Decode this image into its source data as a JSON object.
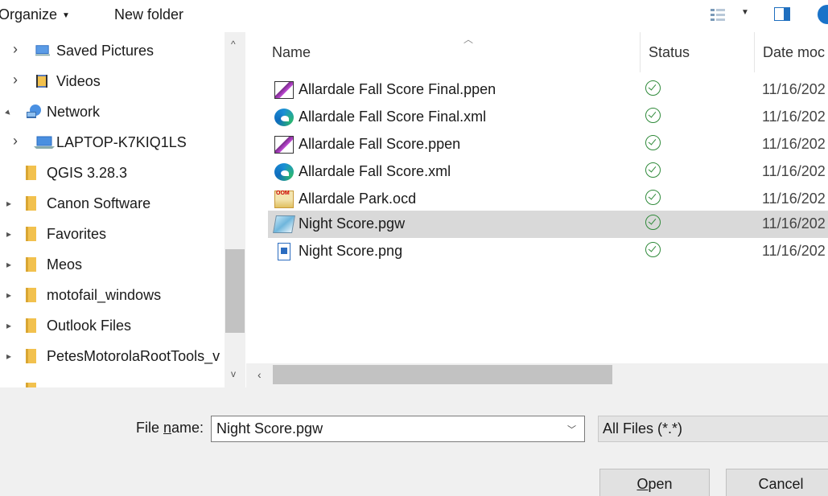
{
  "toolbar": {
    "organize_label": "Organize",
    "new_folder_label": "New folder"
  },
  "nav": {
    "items": [
      {
        "label": "Saved Pictures",
        "icon": "monitor-icon",
        "expander": "collapsed"
      },
      {
        "label": "Videos",
        "icon": "video-folder-icon",
        "expander": "collapsed"
      },
      {
        "label": "Network",
        "icon": "network-icon",
        "expander": "expanded"
      },
      {
        "label": "LAPTOP-K7KIQ1LS",
        "icon": "computer-icon",
        "expander": "collapsed"
      },
      {
        "label": "QGIS 3.28.3",
        "icon": "folder-icon",
        "expander": "none"
      },
      {
        "label": "Canon Software",
        "icon": "folder-icon",
        "expander": "collapsed"
      },
      {
        "label": "Favorites",
        "icon": "folder-icon",
        "expander": "collapsed"
      },
      {
        "label": "Meos",
        "icon": "folder-icon",
        "expander": "collapsed"
      },
      {
        "label": "motofail_windows",
        "icon": "folder-icon",
        "expander": "collapsed"
      },
      {
        "label": "Outlook Files",
        "icon": "folder-icon",
        "expander": "collapsed"
      },
      {
        "label": "PetesMotorolaRootTools_v",
        "icon": "folder-icon",
        "expander": "collapsed"
      }
    ]
  },
  "columns": {
    "name": "Name",
    "status": "Status",
    "date": "Date moc"
  },
  "files": [
    {
      "name": "Allardale Fall Score Final.ppen",
      "icon": "purplepen-icon",
      "status": "synced",
      "date": "11/16/202"
    },
    {
      "name": "Allardale Fall Score Final.xml",
      "icon": "edge-icon",
      "status": "synced",
      "date": "11/16/202"
    },
    {
      "name": "Allardale Fall Score.ppen",
      "icon": "purplepen-icon",
      "status": "synced",
      "date": "11/16/202"
    },
    {
      "name": "Allardale Fall Score.xml",
      "icon": "edge-icon",
      "status": "synced",
      "date": "11/16/202"
    },
    {
      "name": "Allardale Park.ocd",
      "icon": "ocad-icon",
      "status": "synced",
      "date": "11/16/202"
    },
    {
      "name": "Night Score.pgw",
      "icon": "pgw-file-icon",
      "status": "synced",
      "date": "11/16/202",
      "selected": true
    },
    {
      "name": "Night Score.png",
      "icon": "image-file-icon",
      "status": "synced",
      "date": "11/16/202"
    }
  ],
  "bottom": {
    "file_name_label_pre": "File ",
    "file_name_label_u": "n",
    "file_name_label_post": "ame:",
    "file_name_value": "Night Score.pgw",
    "file_type_value": "All Files (*.*)",
    "open_label_u": "O",
    "open_label_post": "pen",
    "cancel_label": "Cancel"
  }
}
